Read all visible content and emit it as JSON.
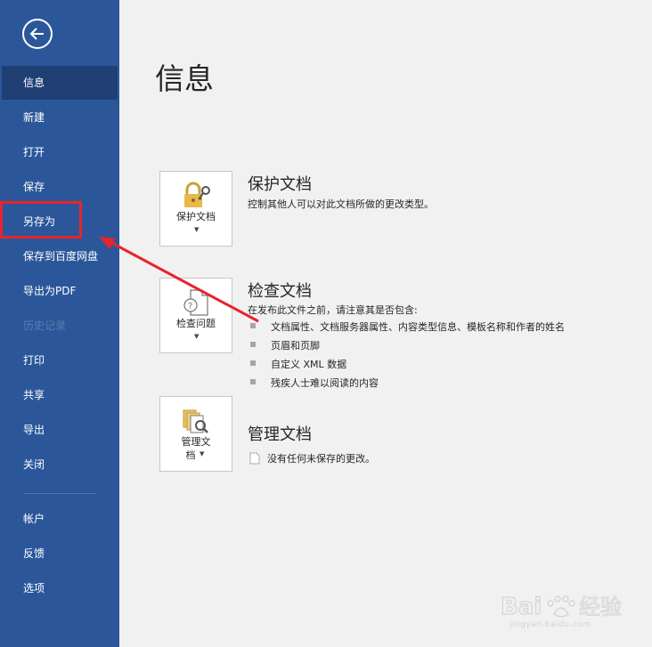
{
  "sidebar": {
    "items": [
      {
        "label": "信息",
        "state": "active"
      },
      {
        "label": "新建",
        "state": "normal"
      },
      {
        "label": "打开",
        "state": "normal"
      },
      {
        "label": "保存",
        "state": "normal"
      },
      {
        "label": "另存为",
        "state": "normal"
      },
      {
        "label": "保存到百度网盘",
        "state": "normal"
      },
      {
        "label": "导出为PDF",
        "state": "normal"
      },
      {
        "label": "历史记录",
        "state": "disabled"
      },
      {
        "label": "打印",
        "state": "normal"
      },
      {
        "label": "共享",
        "state": "normal"
      },
      {
        "label": "导出",
        "state": "normal"
      },
      {
        "label": "关闭",
        "state": "normal"
      }
    ],
    "bottom_items": [
      {
        "label": "帐户"
      },
      {
        "label": "反馈"
      },
      {
        "label": "选项"
      }
    ]
  },
  "main": {
    "title": "信息",
    "protect": {
      "tile_label": "保护文档",
      "title": "保护文档",
      "description": "控制其他人可以对此文档所做的更改类型。"
    },
    "inspect": {
      "tile_label": "检查问题",
      "title": "检查文档",
      "description": "在发布此文件之前，请注意其是否包含:",
      "bullets": [
        "文档属性、文档服务器属性、内容类型信息、模板名称和作者的姓名",
        "页眉和页脚",
        "自定义 XML 数据",
        "残疾人士难以阅读的内容"
      ]
    },
    "manage": {
      "tile_label_line1": "管理文",
      "tile_label_line2": "档",
      "title": "管理文档",
      "description": "没有任何未保存的更改。"
    }
  },
  "watermark": {
    "brand": "Bai",
    "brand2": "经验",
    "url": "jingyan.baidu.com"
  },
  "colors": {
    "sidebar": "#2b579a",
    "sidebar_active": "#1f3f75",
    "annotation": "#e8242c"
  }
}
